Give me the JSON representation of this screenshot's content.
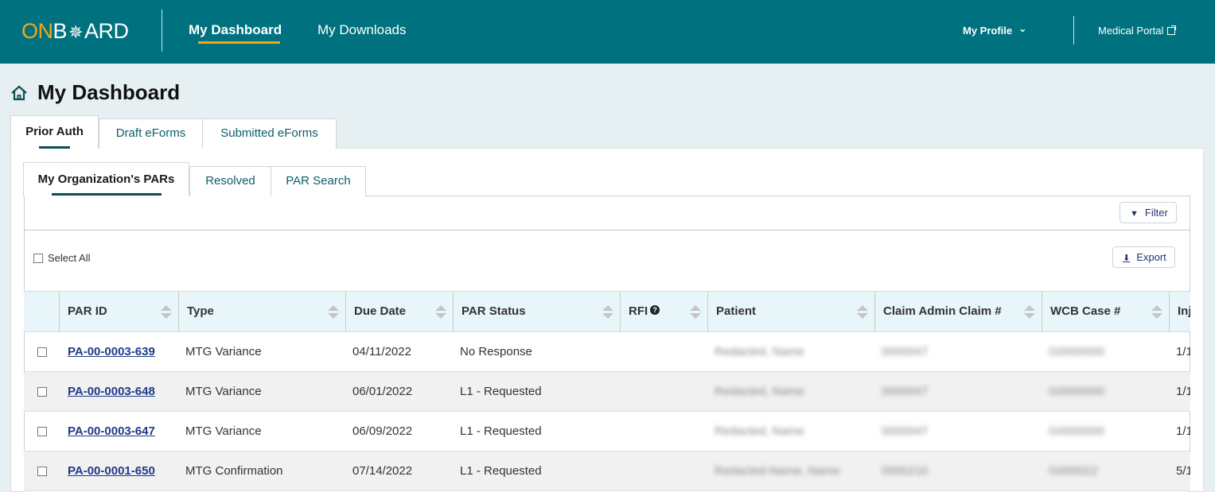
{
  "header": {
    "logo": {
      "on": "ON",
      "star": "✵",
      "rest_b": "B",
      "rest": "ARD"
    },
    "nav": [
      {
        "label": "My Dashboard",
        "active": true
      },
      {
        "label": "My Downloads",
        "active": false
      }
    ],
    "profile_label": "My Profile",
    "profile_chevron": "⌄",
    "portal_label": "Medical Portal",
    "accent_color": "#f2a818",
    "brand_color": "#00727f"
  },
  "page": {
    "title": "My Dashboard"
  },
  "tabs": [
    {
      "label": "Prior Auth",
      "active": true
    },
    {
      "label": "Draft eForms",
      "active": false
    },
    {
      "label": "Submitted eForms",
      "active": false
    }
  ],
  "subtabs": [
    {
      "label": "My Organization's PARs",
      "active": true
    },
    {
      "label": "Resolved",
      "active": false
    },
    {
      "label": "PAR Search",
      "active": false
    }
  ],
  "toolbar": {
    "filter_label": "Filter",
    "export_label": "Export",
    "select_all_label": "Select All"
  },
  "table": {
    "columns": [
      "PAR ID",
      "Type",
      "Due Date",
      "PAR Status",
      "RFI",
      "Patient",
      "Claim Admin Claim #",
      "WCB Case #",
      "Inj"
    ],
    "rows": [
      {
        "par_id": "PA-00-0003-639",
        "type": "MTG Variance",
        "due_date": "04/11/2022",
        "status": "No Response",
        "rfi": "",
        "patient": "Redacted, Name",
        "claim": "0000047",
        "wcb": "G0000000",
        "inj": "1/1"
      },
      {
        "par_id": "PA-00-0003-648",
        "type": "MTG Variance",
        "due_date": "06/01/2022",
        "status": "L1 - Requested",
        "rfi": "",
        "patient": "Redacted, Name",
        "claim": "0000047",
        "wcb": "G0000000",
        "inj": "1/1"
      },
      {
        "par_id": "PA-00-0003-647",
        "type": "MTG Variance",
        "due_date": "06/09/2022",
        "status": "L1 - Requested",
        "rfi": "",
        "patient": "Redacted, Name",
        "claim": "0000047",
        "wcb": "G0000000",
        "inj": "1/1"
      },
      {
        "par_id": "PA-00-0001-650",
        "type": "MTG Confirmation",
        "due_date": "07/14/2022",
        "status": "L1 - Requested",
        "rfi": "",
        "patient": "Redacted-Name, Name",
        "claim": "0000210",
        "wcb": "G000022",
        "inj": "5/1"
      }
    ]
  }
}
